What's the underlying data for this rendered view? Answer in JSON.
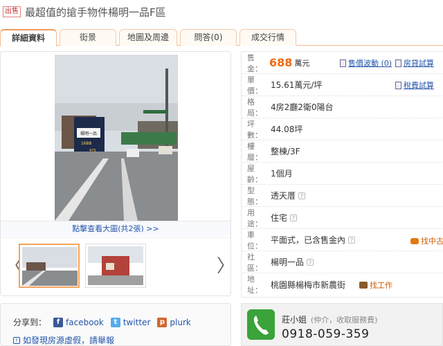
{
  "header": {
    "tag": "出售",
    "title": "最超值的搶手物件楊明一品F區"
  },
  "tabs": [
    "詳細資料",
    "街景",
    "地圖及周邊",
    "問答(0)",
    "成交行情"
  ],
  "gallery": {
    "view_link": "點擊查看大圖(共2張) >>",
    "prev_arrow": "〈",
    "next_arrow": "〉",
    "photo_sign_text": [
      "楊明一品",
      "1688",
      "475"
    ]
  },
  "share": {
    "label": "分享到：",
    "items": [
      {
        "name": "facebook",
        "icon": "f",
        "color": "#3b5998"
      },
      {
        "name": "twitter",
        "icon": "t",
        "color": "#55acee"
      },
      {
        "name": "plurk",
        "icon": "p",
        "color": "#cf682f"
      }
    ],
    "report": "如發現房源虛假，請舉報"
  },
  "info": {
    "price_label": "售金：",
    "price": "688",
    "price_unit": "萬元",
    "price_history": "售價波動 (0)",
    "loan_calc": "房貸試算",
    "tax_calc": "稅費試算",
    "rows": [
      {
        "label": "單價：",
        "value": "15.61萬元/坪"
      },
      {
        "label": "格局：",
        "value": "4房2廳2衛0陽台"
      },
      {
        "label": "坪數：",
        "value": "44.08坪"
      },
      {
        "label": "樓層：",
        "value": "整棟/3F"
      },
      {
        "label": "屋齡：",
        "value": "1個月"
      },
      {
        "label": "型態：",
        "value": "透天厝"
      },
      {
        "label": "用途：",
        "value": "住宅"
      },
      {
        "label": "車位：",
        "value": "平面式，已含售金內"
      },
      {
        "label": "社區：",
        "value": "楊明一品"
      },
      {
        "label": "地址：",
        "value": "桃園縣楊梅市新農街"
      }
    ],
    "find_parking": "找中古",
    "find_work": "找工作"
  },
  "contact": {
    "name": "莊小姐",
    "note": "(仲介，收取服務費)",
    "phone": "0918-059-359"
  },
  "colors": {
    "accent": "#f06a10",
    "link": "#2255aa",
    "tab_border": "#f3b98f"
  }
}
